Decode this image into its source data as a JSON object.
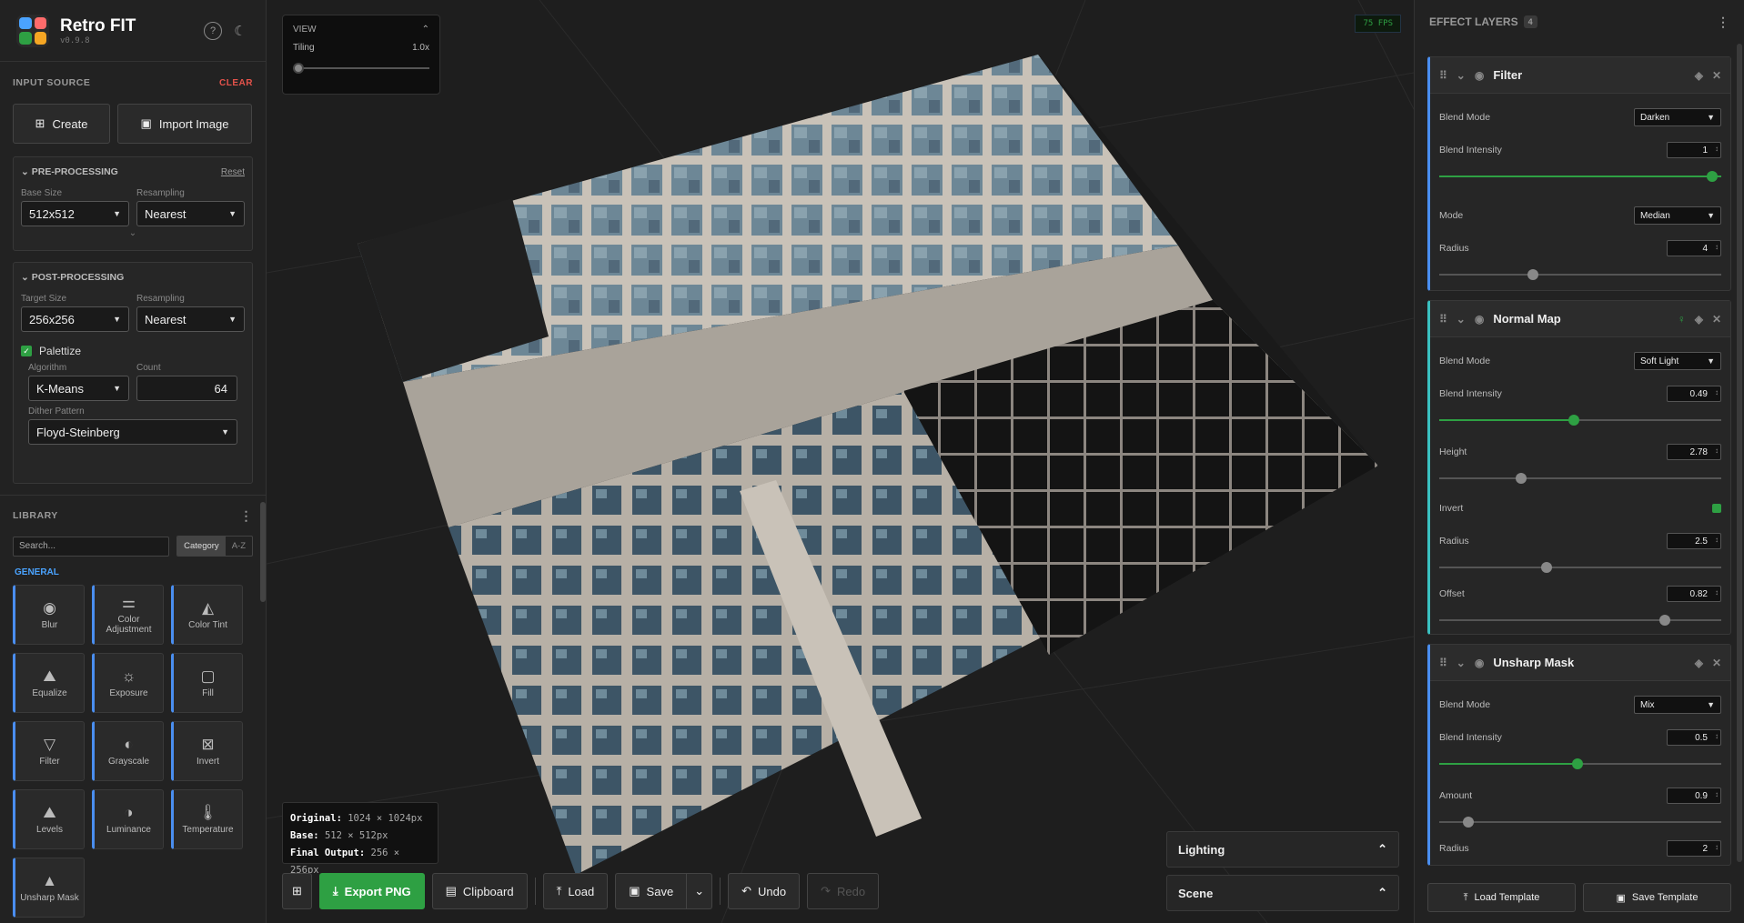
{
  "brand": {
    "title": "Retro FIT",
    "version": "v0.9.8"
  },
  "input_source": {
    "title": "INPUT SOURCE",
    "clear": "CLEAR",
    "create": "Create",
    "import": "Import Image"
  },
  "pre": {
    "title": "PRE-PROCESSING",
    "reset": "Reset",
    "base_label": "Base Size",
    "base_value": "512x512",
    "resample_label": "Resampling",
    "resample_value": "Nearest"
  },
  "post": {
    "title": "POST-PROCESSING",
    "target_label": "Target Size",
    "target_value": "256x256",
    "resample_label": "Resampling",
    "resample_value": "Nearest",
    "palettize": "Palettize",
    "algo_label": "Algorithm",
    "algo_value": "K-Means",
    "count_label": "Count",
    "count_value": "64",
    "dither_label": "Dither Pattern",
    "dither_value": "Floyd-Steinberg"
  },
  "library": {
    "title": "LIBRARY",
    "search_placeholder": "Search...",
    "sort_category": "Category",
    "sort_az": "A-Z",
    "group": "GENERAL",
    "items": [
      "Blur",
      "Color Adjustment",
      "Color Tint",
      "Equalize",
      "Exposure",
      "Fill",
      "Filter",
      "Grayscale",
      "Invert",
      "Levels",
      "Luminance",
      "Temperature",
      "Unsharp Mask"
    ]
  },
  "view": {
    "title": "VIEW",
    "tiling_label": "Tiling",
    "tiling_value": "1.0x",
    "tiling_fraction": 0.0
  },
  "fps": "75 FPS",
  "info": {
    "original_label": "Original:",
    "original": "1024 × 1024px",
    "base_label": "Base:",
    "base": "512 × 512px",
    "final_label": "Final Output:",
    "final": "256 × 256px"
  },
  "toolbar": {
    "export": "Export PNG",
    "clipboard": "Clipboard",
    "load": "Load",
    "save": "Save",
    "undo": "Undo",
    "redo": "Redo"
  },
  "accordions": {
    "lighting": "Lighting",
    "scene": "Scene"
  },
  "layers": {
    "title": "EFFECT LAYERS",
    "count": "4",
    "filter": {
      "name": "Filter",
      "blend_mode_label": "Blend Mode",
      "blend_mode": "Darken",
      "intensity_label": "Blend Intensity",
      "intensity": "1",
      "mode_label": "Mode",
      "mode": "Median",
      "radius_label": "Radius",
      "radius": "4"
    },
    "normal": {
      "name": "Normal Map",
      "blend_mode_label": "Blend Mode",
      "blend_mode": "Soft Light",
      "intensity_label": "Blend Intensity",
      "intensity": "0.49",
      "height_label": "Height",
      "height": "2.78",
      "invert_label": "Invert",
      "radius_label": "Radius",
      "radius": "2.5",
      "offset_label": "Offset",
      "offset": "0.82"
    },
    "unsharp": {
      "name": "Unsharp Mask",
      "blend_mode_label": "Blend Mode",
      "blend_mode": "Mix",
      "intensity_label": "Blend Intensity",
      "intensity": "0.5",
      "amount_label": "Amount",
      "amount": "0.9",
      "radius_label": "Radius",
      "radius": "2"
    },
    "load_template": "Load Template",
    "save_template": "Save Template"
  },
  "colors": {
    "accent_green": "#2ea043",
    "accent_blue": "#4a8ef0",
    "danger": "#e5534b"
  }
}
